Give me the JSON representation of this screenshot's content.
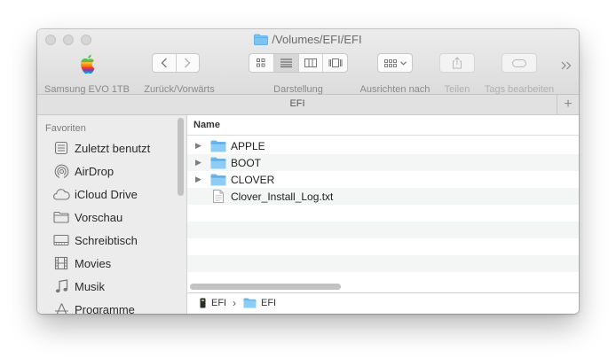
{
  "window": {
    "title": "/Volumes/EFI/EFI"
  },
  "toolbar": {
    "device_label": "Samsung EVO 1TB",
    "nav_label": "Zurück/Vorwärts",
    "view_label": "Darstellung",
    "arrange_label": "Ausrichten nach",
    "share_label": "Teilen",
    "tags_label": "Tags bearbeiten",
    "overflow": "»"
  },
  "tabbar": {
    "label": "EFI",
    "add": "+"
  },
  "sidebar": {
    "header": "Favoriten",
    "items": [
      {
        "label": "Zuletzt benutzt",
        "icon": "recents-icon"
      },
      {
        "label": "AirDrop",
        "icon": "airdrop-icon"
      },
      {
        "label": "iCloud Drive",
        "icon": "cloud-icon"
      },
      {
        "label": "Vorschau",
        "icon": "folder-icon"
      },
      {
        "label": "Schreibtisch",
        "icon": "desktop-icon"
      },
      {
        "label": "Movies",
        "icon": "film-icon"
      },
      {
        "label": "Musik",
        "icon": "music-icon"
      },
      {
        "label": "Programme",
        "icon": "apps-icon"
      }
    ]
  },
  "list": {
    "column_name": "Name",
    "rows": [
      {
        "name": "APPLE",
        "type": "folder"
      },
      {
        "name": "BOOT",
        "type": "folder"
      },
      {
        "name": "CLOVER",
        "type": "folder"
      },
      {
        "name": "Clover_Install_Log.txt",
        "type": "file"
      }
    ]
  },
  "pathbar": {
    "items": [
      "EFI",
      "EFI"
    ],
    "separator": "›"
  },
  "colors": {
    "folder_blue": "#6cb8ee",
    "folder_blue_dark": "#4aa0e0",
    "window_chrome": "#e3e3e3"
  }
}
